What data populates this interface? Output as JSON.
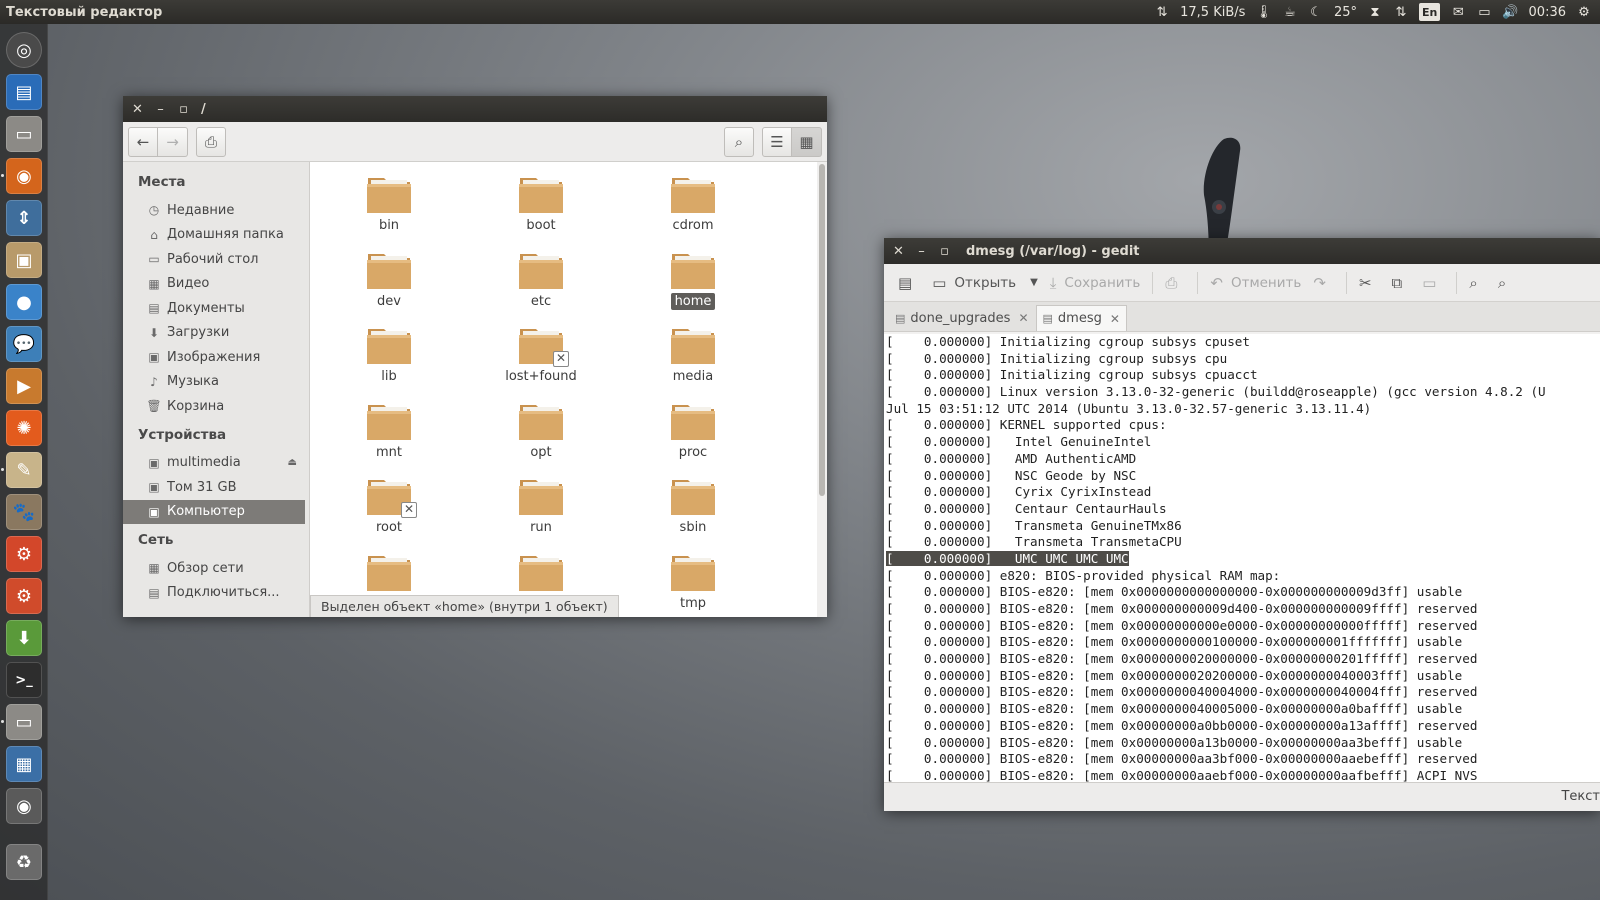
{
  "top_panel": {
    "app_title": "Текстовый редактор",
    "net_speed": "17,5 KiB/s",
    "weather_temp": "25°",
    "keyboard_layout": "En",
    "clock": "00:36"
  },
  "launcher": {
    "items": [
      "dash",
      "libreoffice-writer",
      "files",
      "firefox",
      "update-manager",
      "image-viewer",
      "messaging",
      "chat",
      "media-player",
      "compass",
      "text-editor",
      "gimp",
      "system-settings",
      "settings",
      "software-install",
      "terminal",
      "files-2",
      "workspaces",
      "disk",
      "trash"
    ]
  },
  "file_manager": {
    "title": "/",
    "sidebar": {
      "places_head": "Места",
      "places": [
        "Недавние",
        "Домашняя папка",
        "Рабочий стол",
        "Видео",
        "Документы",
        "Загрузки",
        "Изображения",
        "Музыка",
        "Корзина"
      ],
      "devices_head": "Устройства",
      "devices": [
        "multimedia",
        "Том 31 GB",
        "Компьютер"
      ],
      "network_head": "Сеть",
      "network": [
        "Обзор сети",
        "Подключиться..."
      ]
    },
    "folders": [
      "bin",
      "boot",
      "cdrom",
      "dev",
      "etc",
      "home",
      "lib",
      "lost+found",
      "media",
      "mnt",
      "opt",
      "proc",
      "root",
      "run",
      "sbin",
      "",
      "",
      "tmp"
    ],
    "selected_folder": "home",
    "status": "Выделен объект «home» (внутри 1 объект)"
  },
  "gedit": {
    "title": "dmesg (/var/log) - gedit",
    "toolbar": {
      "open": "Открыть",
      "save": "Сохранить",
      "undo": "Отменить"
    },
    "tabs": [
      "done_upgrades",
      "dmesg"
    ],
    "lines": [
      "[    0.000000] Initializing cgroup subsys cpuset",
      "[    0.000000] Initializing cgroup subsys cpu",
      "[    0.000000] Initializing cgroup subsys cpuacct",
      "[    0.000000] Linux version 3.13.0-32-generic (buildd@roseapple) (gcc version 4.8.2 (U",
      "Jul 15 03:51:12 UTC 2014 (Ubuntu 3.13.0-32.57-generic 3.13.11.4)",
      "[    0.000000] KERNEL supported cpus:",
      "[    0.000000]   Intel GenuineIntel",
      "[    0.000000]   AMD AuthenticAMD",
      "[    0.000000]   NSC Geode by NSC",
      "[    0.000000]   Cyrix CyrixInstead",
      "[    0.000000]   Centaur CentaurHauls",
      "[    0.000000]   Transmeta GenuineTMx86",
      "[    0.000000]   Transmeta TransmetaCPU",
      "[    0.000000]   UMC UMC UMC UMC",
      "[    0.000000] e820: BIOS-provided physical RAM map:",
      "[    0.000000] BIOS-e820: [mem 0x0000000000000000-0x000000000009d3ff] usable",
      "[    0.000000] BIOS-e820: [mem 0x000000000009d400-0x000000000009ffff] reserved",
      "[    0.000000] BIOS-e820: [mem 0x00000000000e0000-0x00000000000fffff] reserved",
      "[    0.000000] BIOS-e820: [mem 0x0000000000100000-0x000000001fffffff] usable",
      "[    0.000000] BIOS-e820: [mem 0x0000000020000000-0x00000000201fffff] reserved",
      "[    0.000000] BIOS-e820: [mem 0x0000000020200000-0x0000000040003fff] usable",
      "[    0.000000] BIOS-e820: [mem 0x0000000040004000-0x0000000040004fff] reserved",
      "[    0.000000] BIOS-e820: [mem 0x0000000040005000-0x00000000a0baffff] usable",
      "[    0.000000] BIOS-e820: [mem 0x00000000a0bb0000-0x00000000a13affff] reserved",
      "[    0.000000] BIOS-e820: [mem 0x00000000a13b0000-0x00000000aa3befff] usable",
      "[    0.000000] BIOS-e820: [mem 0x00000000aa3bf000-0x00000000aaebefff] reserved",
      "[    0.000000] BIOS-e820: [mem 0x00000000aaebf000-0x00000000aafbefff] ACPI NVS"
    ],
    "highlight_line": 13,
    "highlight_prefix": "[    0.000000]",
    "highlight_text": "   UMC UMC UMC UMC",
    "status_text": "Текст"
  }
}
